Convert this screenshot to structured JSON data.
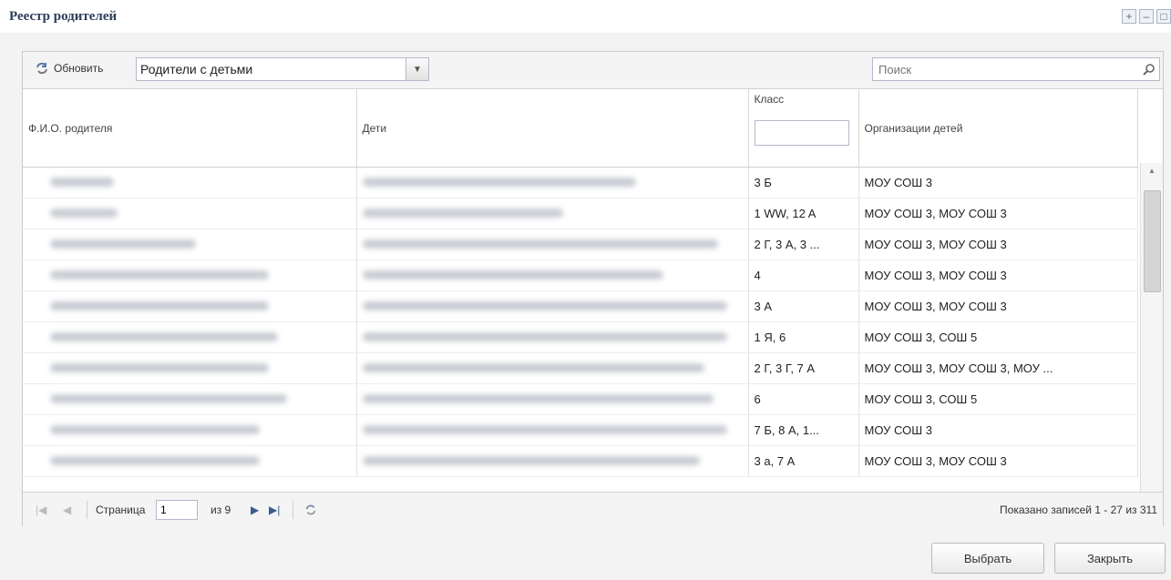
{
  "window": {
    "title": "Реестр родителей"
  },
  "toolbar": {
    "refresh_label": "Обновить",
    "filter_value": "Родители с детьми",
    "search_placeholder": "Поиск"
  },
  "table": {
    "columns": [
      "Ф.И.О. родителя",
      "Дети",
      "Класс",
      "Организации детей"
    ],
    "rows": [
      {
        "klass": "3 Б",
        "orgs": "МОУ СОШ 3"
      },
      {
        "klass": "1 WW, 12 A",
        "orgs": "МОУ СОШ 3, МОУ СОШ 3"
      },
      {
        "klass": "2 Г, 3 А, 3 ...",
        "orgs": "МОУ СОШ 3, МОУ СОШ 3"
      },
      {
        "klass": "4",
        "orgs": "МОУ СОШ 3, МОУ СОШ 3"
      },
      {
        "klass": "3 А",
        "orgs": "МОУ СОШ 3, МОУ СОШ 3"
      },
      {
        "klass": "1 Я, 6",
        "orgs": "МОУ СОШ 3, СОШ 5"
      },
      {
        "klass": "2 Г, 3 Г, 7 А",
        "orgs": "МОУ СОШ 3, МОУ СОШ 3, МОУ ..."
      },
      {
        "klass": "6",
        "orgs": "МОУ СОШ 3, СОШ 5"
      },
      {
        "klass": "7 Б, 8 А, 1...",
        "orgs": "МОУ СОШ 3"
      },
      {
        "klass": "3 а, 7 А",
        "orgs": "МОУ СОШ 3, МОУ СОШ 3"
      }
    ]
  },
  "pager": {
    "page_label": "Страница",
    "page_value": "1",
    "of_label": "из 9",
    "summary": "Показано записей 1 - 27 из 311"
  },
  "buttons": {
    "select": "Выбрать",
    "close": "Закрыть"
  },
  "colors": {
    "title": "#2c3e58",
    "panel_border": "#c9c9c9",
    "pager_icon": "#3b5c8c"
  }
}
